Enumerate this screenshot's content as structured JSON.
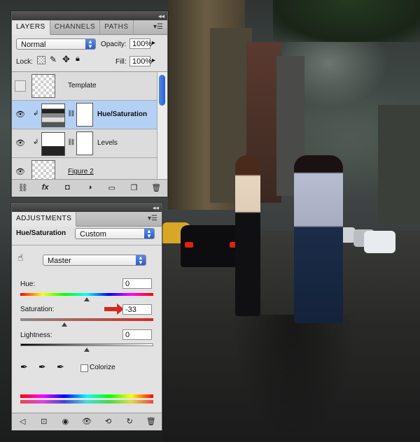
{
  "layers_panel": {
    "tabs": [
      "LAYERS",
      "CHANNELS",
      "PATHS"
    ],
    "blend_mode": "Normal",
    "opacity_label": "Opacity:",
    "opacity_value": "100%",
    "lock_label": "Lock:",
    "fill_label": "Fill:",
    "fill_value": "100%",
    "layers": [
      {
        "name": "Template",
        "visible": false,
        "selected": false
      },
      {
        "name": "Hue/Saturation",
        "visible": true,
        "selected": true
      },
      {
        "name": "Levels",
        "visible": true,
        "selected": false
      },
      {
        "name": "Figure 2",
        "visible": true,
        "selected": false
      }
    ],
    "footer_icons": [
      "link-icon",
      "fx-icon",
      "mask-icon",
      "adjustment-icon",
      "folder-icon",
      "new-layer-icon",
      "trash-icon"
    ],
    "footer_fx_label": "fx"
  },
  "adjustments_panel": {
    "tab": "ADJUSTMENTS",
    "title": "Hue/Saturation",
    "preset": "Custom",
    "channel": "Master",
    "hue_label": "Hue:",
    "hue_value": "0",
    "saturation_label": "Saturation:",
    "saturation_value": "-33",
    "lightness_label": "Lightness:",
    "lightness_value": "0",
    "colorize_label": "Colorize",
    "colorize_checked": false,
    "hue": 0,
    "saturation": -33,
    "lightness": 0,
    "accent_color": "#d22a1f"
  }
}
